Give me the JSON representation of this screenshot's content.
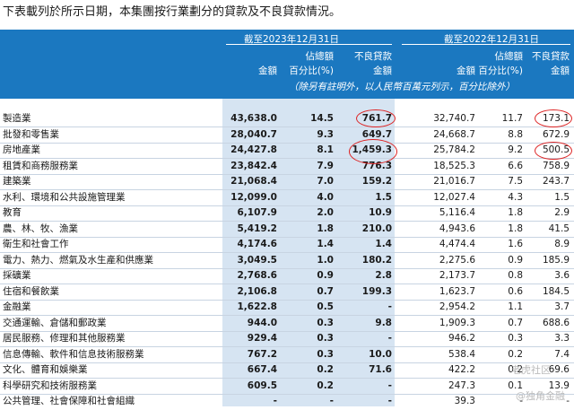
{
  "intro": "下表載列於所示日期，本集團按行業劃分的貸款及不良貸款情況。",
  "header": {
    "period_2023": "截至2023年12月31日",
    "period_2022": "截至2022年12月31日",
    "col_amount": "金額",
    "col_share_top": "佔總額",
    "col_share_bottom": "百分比(%)",
    "col_npl_top": "不良貸款",
    "col_npl_bottom": "金額",
    "unit_note": "（除另有註明外，以人民幣百萬元列示，百分比除外）"
  },
  "rows": [
    {
      "name": "製造業",
      "a1": "43,638.0",
      "p1": "14.5",
      "n1": "761.7",
      "a2": "32,740.7",
      "p2": "11.7",
      "n2": "173.1"
    },
    {
      "name": "批發和零售業",
      "a1": "28,040.7",
      "p1": "9.3",
      "n1": "649.7",
      "a2": "24,668.7",
      "p2": "8.8",
      "n2": "672.9"
    },
    {
      "name": "房地產業",
      "a1": "24,427.8",
      "p1": "8.1",
      "n1": "1,459.3",
      "a2": "25,784.2",
      "p2": "9.2",
      "n2": "500.5"
    },
    {
      "name": "租賃和商務服務業",
      "a1": "23,842.4",
      "p1": "7.9",
      "n1": "776.3",
      "a2": "18,525.3",
      "p2": "6.6",
      "n2": "758.9"
    },
    {
      "name": "建築業",
      "a1": "21,068.4",
      "p1": "7.0",
      "n1": "159.2",
      "a2": "21,016.7",
      "p2": "7.5",
      "n2": "243.7"
    },
    {
      "name": "水利、環境和公共設施管理業",
      "a1": "12,099.0",
      "p1": "4.0",
      "n1": "1.5",
      "a2": "12,027.4",
      "p2": "4.3",
      "n2": "1.5"
    },
    {
      "name": "教育",
      "a1": "6,107.9",
      "p1": "2.0",
      "n1": "10.9",
      "a2": "5,116.4",
      "p2": "1.8",
      "n2": "2.9"
    },
    {
      "name": "農、林、牧、漁業",
      "a1": "5,419.2",
      "p1": "1.8",
      "n1": "210.0",
      "a2": "4,943.6",
      "p2": "1.8",
      "n2": "41.5"
    },
    {
      "name": "衛生和社會工作",
      "a1": "4,174.6",
      "p1": "1.4",
      "n1": "1.4",
      "a2": "4,474.4",
      "p2": "1.6",
      "n2": "8.9"
    },
    {
      "name": "電力、熱力、燃氣及水生產和供應業",
      "a1": "3,049.5",
      "p1": "1.0",
      "n1": "180.2",
      "a2": "2,275.6",
      "p2": "0.9",
      "n2": "185.9"
    },
    {
      "name": "採礦業",
      "a1": "2,768.6",
      "p1": "0.9",
      "n1": "2.8",
      "a2": "2,173.7",
      "p2": "0.8",
      "n2": "3.6"
    },
    {
      "name": "住宿和餐飲業",
      "a1": "2,106.8",
      "p1": "0.7",
      "n1": "199.3",
      "a2": "1,623.7",
      "p2": "0.6",
      "n2": "184.5"
    },
    {
      "name": "金融業",
      "a1": "1,622.8",
      "p1": "0.5",
      "n1": "-",
      "a2": "2,954.2",
      "p2": "1.1",
      "n2": "3.7"
    },
    {
      "name": "交通運輸、倉儲和郵政業",
      "a1": "944.0",
      "p1": "0.3",
      "n1": "9.8",
      "a2": "1,909.3",
      "p2": "0.7",
      "n2": "688.6"
    },
    {
      "name": "居民服務、修理和其他服務業",
      "a1": "929.4",
      "p1": "0.3",
      "n1": "-",
      "a2": "946.2",
      "p2": "0.3",
      "n2": "3.3"
    },
    {
      "name": "信息傳輸、軟件和信息技術服務業",
      "a1": "767.2",
      "p1": "0.3",
      "n1": "10.0",
      "a2": "538.4",
      "p2": "0.2",
      "n2": "7.4"
    },
    {
      "name": "文化、體育和娛樂業",
      "a1": "667.4",
      "p1": "0.2",
      "n1": "71.6",
      "a2": "422.2",
      "p2": "0.2",
      "n2": "69.6"
    },
    {
      "name": "科學研究和技術服務業",
      "a1": "609.5",
      "p1": "0.2",
      "n1": "-",
      "a2": "247.3",
      "p2": "0.1",
      "n2": "13.9"
    },
    {
      "name": "公共管理、社會保障和社會組織",
      "a1": "-",
      "p1": "-",
      "n1": "-",
      "a2": "39.3",
      "p2": "-",
      "n2": "-"
    }
  ],
  "watermarks": {
    "top": "老虎社区",
    "bottom": "@独角金融"
  }
}
